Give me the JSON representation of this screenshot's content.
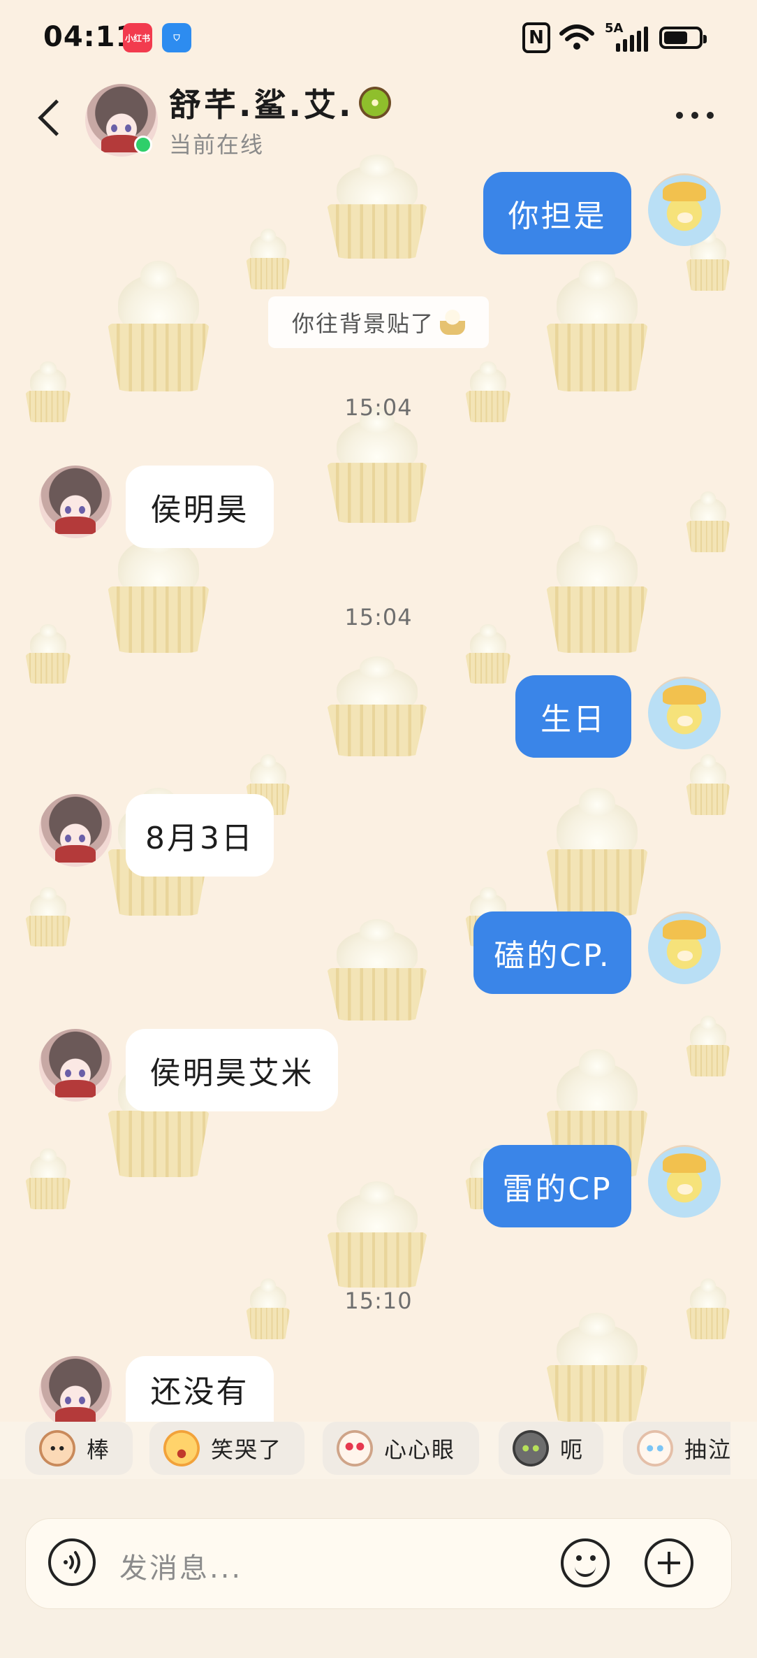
{
  "status_bar": {
    "time": "04:11",
    "app_badges": [
      "小红书",
      "⛉"
    ],
    "nfc": "N",
    "network": "5A"
  },
  "header": {
    "contact_name": "舒芊.鲨.艾.",
    "contact_status": "当前在线"
  },
  "chat": {
    "system_note": "你往背景贴了",
    "timestamps": [
      "15:04",
      "15:04",
      "15:10"
    ],
    "messages": [
      {
        "dir": "out",
        "text": "你担是"
      },
      {
        "dir": "in",
        "text": "侯明昊"
      },
      {
        "dir": "out",
        "text": "生日"
      },
      {
        "dir": "in",
        "text": "8月3日"
      },
      {
        "dir": "out",
        "text": "磕的CP."
      },
      {
        "dir": "in",
        "text": "侯明昊艾米"
      },
      {
        "dir": "out",
        "text": "雷的CP"
      },
      {
        "dir": "in",
        "text": "还没有"
      }
    ]
  },
  "quick_replies": [
    "棒",
    "笑哭了",
    "心心眼",
    "呃",
    "抽泣"
  ],
  "input": {
    "placeholder": "发消息..."
  },
  "colors": {
    "background": "#fbf0e2",
    "outgoing_bubble": "#3a85e8",
    "incoming_bubble": "#ffffff",
    "online": "#2fcf6a"
  }
}
